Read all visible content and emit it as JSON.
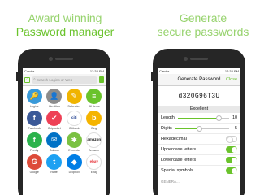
{
  "left_headline": {
    "line1": "Award winning",
    "line2": "Password manager"
  },
  "right_headline": {
    "line1": "Generate",
    "line2": "secure passwords"
  },
  "left_phone": {
    "status": {
      "carrier": "Carrier",
      "time": "12:34 PM"
    },
    "search": {
      "placeholder": "Search Logins or Web"
    },
    "tiles": [
      {
        "label": "Logins",
        "glyph": "🔑",
        "color": "#3a9ad9"
      },
      {
        "label": "Identities",
        "glyph": "👤",
        "color": "#8c8c8c"
      },
      {
        "label": "Safenotes",
        "glyph": "✎",
        "color": "#f0b400"
      },
      {
        "label": "All Items",
        "glyph": "≡",
        "color": "#6ac32c"
      },
      {
        "label": "Facebook",
        "glyph": "f",
        "color": "#3b5998"
      },
      {
        "label": "Getpocket",
        "glyph": "✔",
        "color": "#ee4056"
      },
      {
        "label": "Citibank",
        "glyph": "citi",
        "color": "#ffffff",
        "text_color": "#1a3a8c"
      },
      {
        "label": "Bing",
        "glyph": "b",
        "color": "#f5b400"
      },
      {
        "label": "Feedly",
        "glyph": "f",
        "color": "#2bb24c"
      },
      {
        "label": "Outlook",
        "glyph": "✉",
        "color": "#0072c6"
      },
      {
        "label": "Evernote",
        "glyph": "✱",
        "color": "#7ac142"
      },
      {
        "label": "Amazon",
        "glyph": "amazon",
        "color": "#ffffff",
        "text_color": "#111111"
      },
      {
        "label": "Google",
        "glyph": "G",
        "color": "#dd4b39"
      },
      {
        "label": "Twitter",
        "glyph": "t",
        "color": "#1da1f2"
      },
      {
        "label": "Dropbox",
        "glyph": "◆",
        "color": "#007ee5"
      },
      {
        "label": "Ebay",
        "glyph": "ebay",
        "color": "#ffffff",
        "text_color": "#e53238"
      }
    ]
  },
  "right_phone": {
    "status": {
      "carrier": "Carrier",
      "time": "12:34 PM"
    },
    "title": "Generate Password",
    "close_label": "Close",
    "password": "d320G96T3U",
    "strength": "Excellent",
    "length": {
      "label": "Length",
      "value": "10",
      "fraction": 0.8
    },
    "digits": {
      "label": "Digits",
      "value": "5",
      "fraction": 0.45
    },
    "options": [
      {
        "label": "Hexadecimal",
        "on": false
      },
      {
        "label": "Uppercase letters",
        "on": true
      },
      {
        "label": "Lowercase letters",
        "on": true
      },
      {
        "label": "Special symbols",
        "on": true
      }
    ],
    "footer_partial": "GENERA..."
  }
}
